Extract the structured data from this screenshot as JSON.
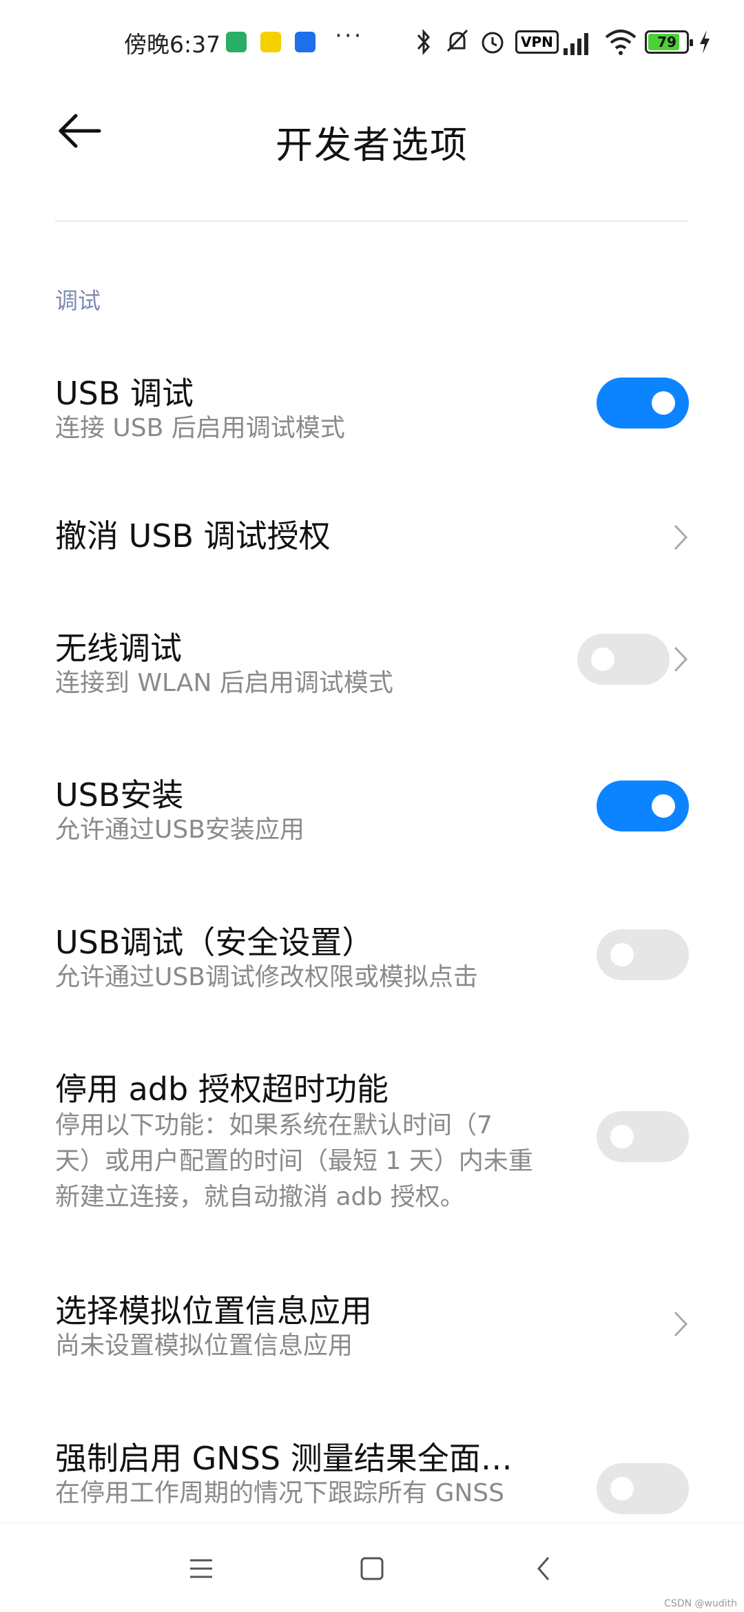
{
  "status_bar": {
    "time": "傍晚6:37",
    "more": "···",
    "vpn_label": "VPN",
    "battery_level": "79",
    "icons": [
      "wechat-icon",
      "notes-app-icon",
      "blue-app-icon",
      "bluetooth-icon",
      "mute-icon",
      "alarm-icon",
      "vpn-icon",
      "hd-signal-icon",
      "wifi-icon",
      "battery-icon",
      "charging-icon"
    ]
  },
  "header": {
    "title": "开发者选项",
    "back_icon": "arrow-left-icon"
  },
  "section": {
    "title": "调试"
  },
  "settings": [
    {
      "title": "USB 调试",
      "subtitle": "连接 USB 后启用调试模式",
      "control": "toggle",
      "state": "on"
    },
    {
      "title": "撤消 USB 调试授权",
      "subtitle": "",
      "control": "chevron"
    },
    {
      "title": "无线调试",
      "subtitle": "连接到 WLAN 后启用调试模式",
      "control": "toggle+chevron",
      "state": "off"
    },
    {
      "title": "USB安装",
      "subtitle": "允许通过USB安装应用",
      "control": "toggle",
      "state": "on"
    },
    {
      "title": "USB调试（安全设置）",
      "subtitle": "允许通过USB调试修改权限或模拟点击",
      "control": "toggle",
      "state": "off"
    },
    {
      "title": "停用 adb 授权超时功能",
      "subtitle_lines": [
        "停用以下功能：如果系统在默认时间（7",
        "天）或用户配置的时间（最短 1 天）内未重",
        "新建立连接，就自动撤消 adb 授权。"
      ],
      "control": "toggle",
      "state": "off"
    },
    {
      "title": "选择模拟位置信息应用",
      "subtitle": "尚未设置模拟位置信息应用",
      "control": "chevron"
    },
    {
      "title": "强制启用 GNSS 测量结果全面…",
      "subtitle": "在停用工作周期的情况下跟踪所有 GNSS",
      "control": "toggle",
      "state": "off"
    }
  ],
  "nav_bar": {
    "buttons": [
      "menu-icon",
      "home-icon",
      "back-icon"
    ]
  },
  "watermark": "CSDN @wudith",
  "colors": {
    "accent": "#0c84ff",
    "toggle_off": "#e6e6e6",
    "section_title": "#7d8ab2",
    "subtitle": "#8a8a8a"
  }
}
